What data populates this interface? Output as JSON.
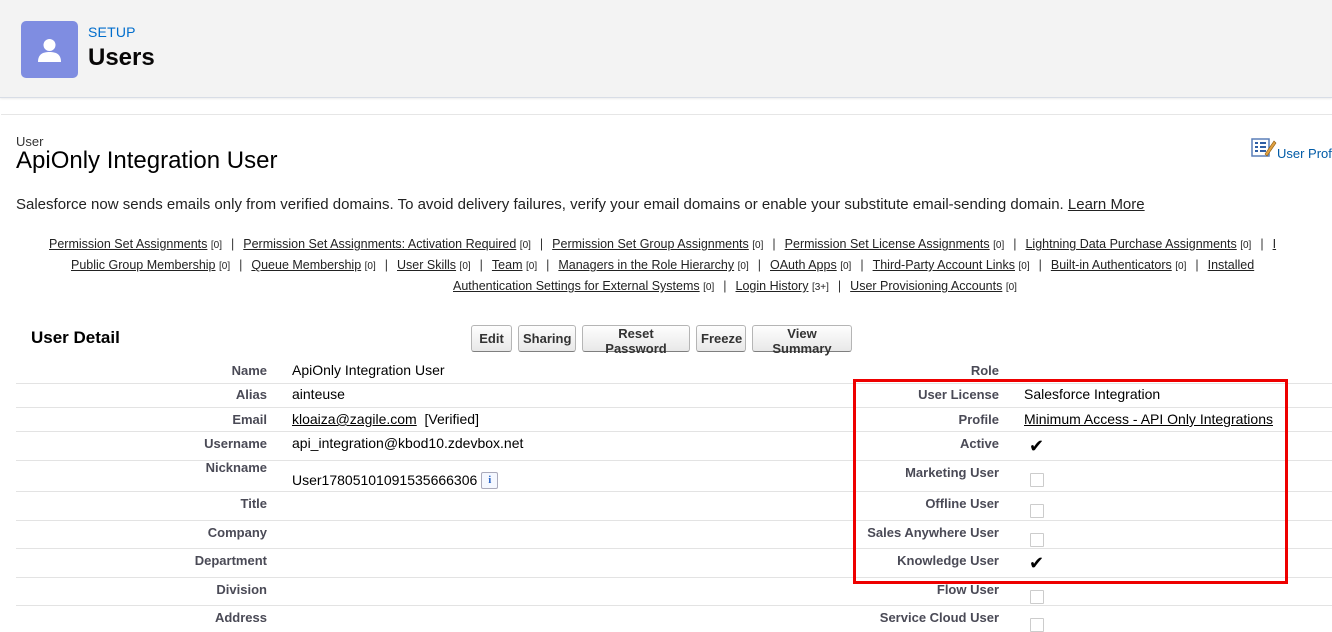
{
  "header": {
    "section_label": "SETUP",
    "title": "Users"
  },
  "record": {
    "type_label": "User",
    "name": "ApiOnly Integration User",
    "profile_link": "User Prof"
  },
  "notice": {
    "text": "Salesforce now sends emails only from verified domains. To avoid delivery failures, verify your email domains or enable your substitute email-sending domain.",
    "link": "Learn More"
  },
  "related_lists": [
    [
      {
        "label": "Permission Set Assignments",
        "count": "[0]"
      },
      {
        "label": "Permission Set Assignments: Activation Required",
        "count": "[0]"
      },
      {
        "label": "Permission Set Group Assignments",
        "count": "[0]"
      },
      {
        "label": "Permission Set License Assignments",
        "count": "[0]"
      },
      {
        "label": "Lightning Data Purchase Assignments",
        "count": "[0]"
      },
      {
        "label": "I",
        "count": ""
      }
    ],
    [
      {
        "label": "Public Group Membership",
        "count": "[0]"
      },
      {
        "label": "Queue Membership",
        "count": "[0]"
      },
      {
        "label": "User Skills",
        "count": "[0]"
      },
      {
        "label": "Team",
        "count": "[0]"
      },
      {
        "label": "Managers in the Role Hierarchy",
        "count": "[0]"
      },
      {
        "label": "OAuth Apps",
        "count": "[0]"
      },
      {
        "label": "Third-Party Account Links",
        "count": "[0]"
      },
      {
        "label": "Built-in Authenticators",
        "count": "[0]"
      },
      {
        "label": "Installed",
        "count": ""
      }
    ],
    [
      {
        "label": "Authentication Settings for External Systems",
        "count": "[0]"
      },
      {
        "label": "Login History",
        "count": "[3+]"
      },
      {
        "label": "User Provisioning Accounts",
        "count": "[0]"
      }
    ]
  ],
  "detail": {
    "title": "User Detail",
    "buttons": [
      "Edit",
      "Sharing",
      "Reset Password",
      "Freeze",
      "View Summary"
    ],
    "left": [
      {
        "label": "Name",
        "value": "ApiOnly Integration User"
      },
      {
        "label": "Alias",
        "value": "ainteuse"
      },
      {
        "label": "Email",
        "value": "kloaiza@zagile.com",
        "suffix": "[Verified]"
      },
      {
        "label": "Username",
        "value": "api_integration@kbod10.zdevbox.net"
      },
      {
        "label": "Nickname",
        "value": "User17805101091535666306"
      },
      {
        "label": "Title",
        "value": ""
      },
      {
        "label": "Company",
        "value": ""
      },
      {
        "label": "Department",
        "value": ""
      },
      {
        "label": "Division",
        "value": ""
      },
      {
        "label": "Address",
        "value": ""
      }
    ],
    "right": [
      {
        "label": "Role",
        "value": ""
      },
      {
        "label": "User License",
        "value": "Salesforce Integration"
      },
      {
        "label": "Profile",
        "value": "Minimum Access - API Only Integrations"
      },
      {
        "label": "Active",
        "checked": true
      },
      {
        "label": "Marketing User",
        "checked": false
      },
      {
        "label": "Offline User",
        "checked": false
      },
      {
        "label": "Sales Anywhere User",
        "checked": false
      },
      {
        "label": "Knowledge User",
        "checked": true
      },
      {
        "label": "Flow User",
        "checked": false
      },
      {
        "label": "Service Cloud User",
        "checked": false
      }
    ]
  },
  "colors": {
    "header_icon_bg": "#7f8de1",
    "link_blue": "#006dcc",
    "highlight_red": "#e00000"
  }
}
